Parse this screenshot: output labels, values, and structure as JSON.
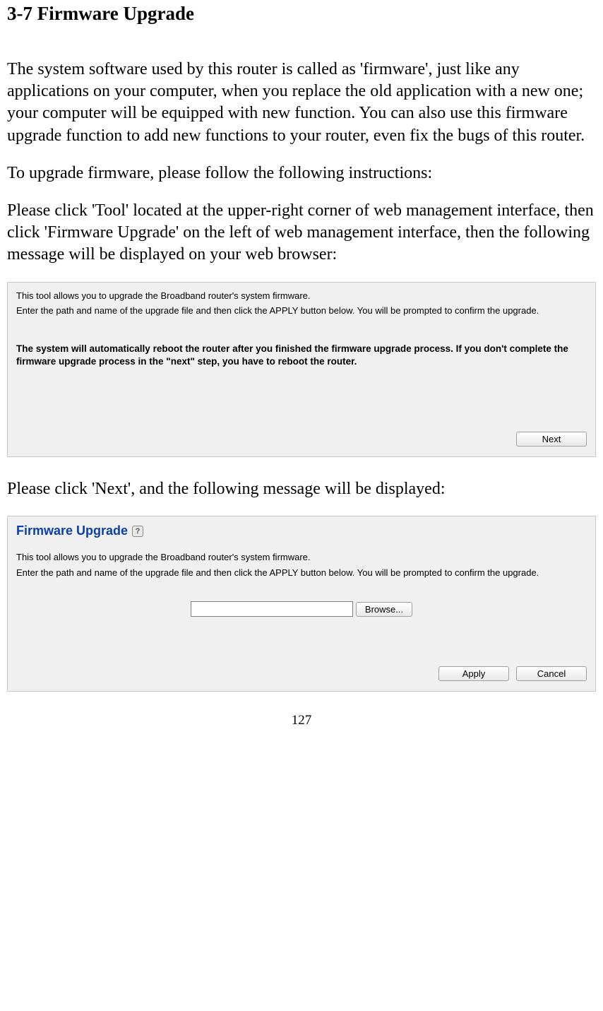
{
  "heading": "3-7 Firmware Upgrade",
  "para1": "The system software used by this router is called as 'firmware', just like any applications on your computer, when you replace the old application with a new one; your computer will be equipped with new function. You can also use this firmware upgrade function to add new functions to your router, even fix the bugs of this router.",
  "para2": "To upgrade firmware, please follow the following instructions:",
  "para3": "Please click 'Tool' located at the upper-right corner of web management interface, then click 'Firmware Upgrade' on the left of web management interface, then the following message will be displayed on your web browser:",
  "panel1": {
    "line1": "This tool allows you to upgrade the Broadband router's system firmware.",
    "line2": "Enter the path and name of the upgrade file and then click the APPLY button below. You will be prompted to confirm the upgrade.",
    "bold": "The system will automatically reboot the router after you finished the firmware upgrade process. If you don't complete the firmware upgrade process in the \"next\" step, you have to reboot the router.",
    "next_label": "Next"
  },
  "para4": "Please click 'Next', and the following message will be displayed:",
  "panel2": {
    "title": "Firmware Upgrade",
    "help": "?",
    "line1": "This tool allows you to upgrade the Broadband router's system firmware.",
    "line2": "Enter the path and name of the upgrade file and then click the APPLY button below. You will be prompted to confirm the upgrade.",
    "file_value": "",
    "browse_label": "Browse...",
    "apply_label": "Apply",
    "cancel_label": "Cancel"
  },
  "page_number": "127"
}
